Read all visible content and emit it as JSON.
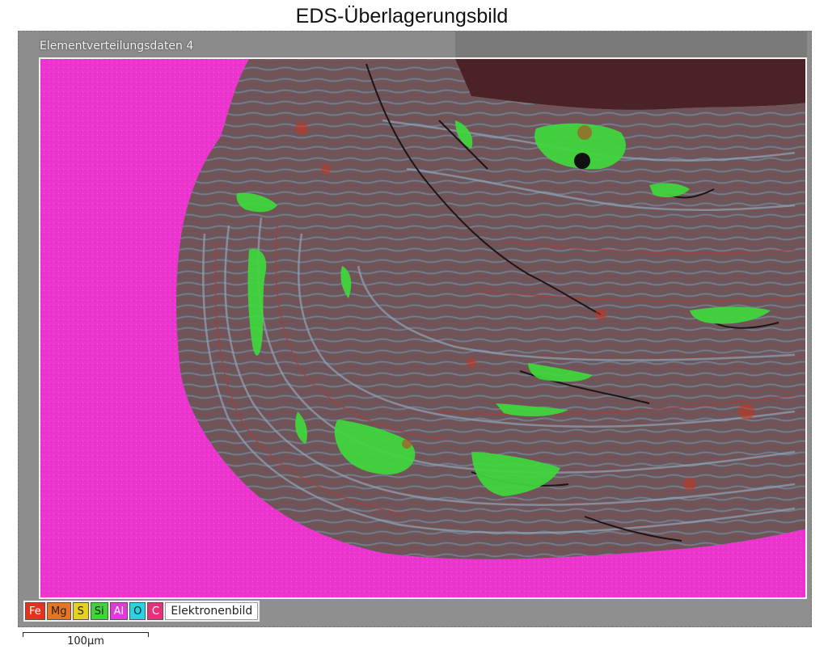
{
  "title": "EDS-Überlagerungsbild",
  "map_label": "Elementverteilungsdaten 4",
  "legend": [
    {
      "label": "Fe",
      "color": "#e8301c"
    },
    {
      "label": "Mg",
      "color": "#e8741c"
    },
    {
      "label": "S",
      "color": "#e6d21a"
    },
    {
      "label": "Si",
      "color": "#3fd43a"
    },
    {
      "label": "Al",
      "color": "#e13ad8"
    },
    {
      "label": "O",
      "color": "#27d4e6"
    },
    {
      "label": "C",
      "color": "#e8307a"
    }
  ],
  "legend_extra": "Elektronenbild",
  "scale_bar": "100µm",
  "colors": {
    "resin": "#ec35cf",
    "sample": "#6f5a5e",
    "silicon_phase": "#3fd83c",
    "background": "#8a8a8a"
  }
}
